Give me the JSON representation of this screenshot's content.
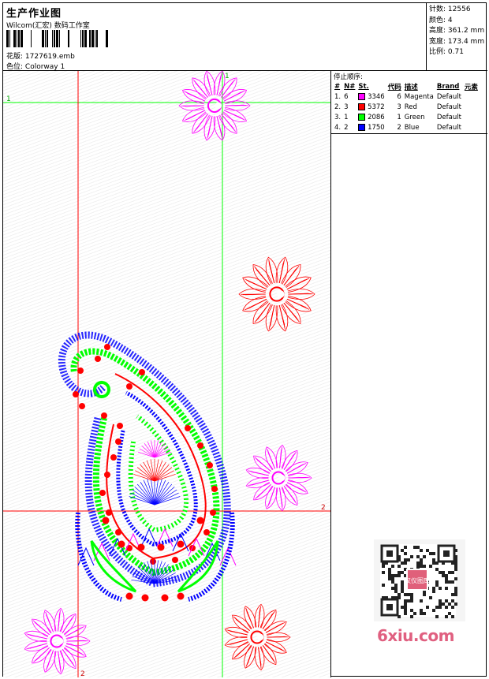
{
  "header": {
    "title": "生产作业图",
    "company": "Wilcom(汇宏) 数码工作室",
    "pattern_label": "花版:",
    "pattern_value": "1727619.emb",
    "color_label": "色位:",
    "color_value": "Colorway 1"
  },
  "stats": {
    "stitches_label": "针数:",
    "stitches_value": "12556",
    "colors_label": "颜色:",
    "colors_value": "4",
    "height_label": "高度:",
    "height_value": "361.2 mm",
    "width_label": "宽度:",
    "width_value": "173.4 mm",
    "scale_label": "比例:",
    "scale_value": "0.71"
  },
  "stop_sequence": {
    "title": "停止顺序:",
    "columns": [
      "#",
      "N#",
      "St.",
      "代码",
      "描述",
      "Brand",
      "元素"
    ],
    "rows": [
      {
        "no": "1.",
        "n": "6",
        "swatch": "#ff00ff",
        "st": "3346",
        "code": "6",
        "desc": "Magenta",
        "brand": "Default"
      },
      {
        "no": "2.",
        "n": "3",
        "swatch": "#ff0000",
        "st": "5372",
        "code": "3",
        "desc": "Red",
        "brand": "Default"
      },
      {
        "no": "3.",
        "n": "1",
        "swatch": "#00ff00",
        "st": "2086",
        "code": "1",
        "desc": "Green",
        "brand": "Default"
      },
      {
        "no": "4.",
        "n": "2",
        "swatch": "#0000ff",
        "st": "1750",
        "code": "2",
        "desc": "Blue",
        "brand": "Default"
      }
    ]
  },
  "guides": {
    "green_label_1": "1",
    "green_label_1b": "1",
    "red_label_2": "2",
    "red_label_2b": "2"
  },
  "watermark": {
    "text": "6xiu.com",
    "qr_badge": "汉仪图库"
  },
  "colors": {
    "magenta": "#ff00ff",
    "red": "#ff0000",
    "green": "#00ff00",
    "blue": "#0000ff"
  }
}
